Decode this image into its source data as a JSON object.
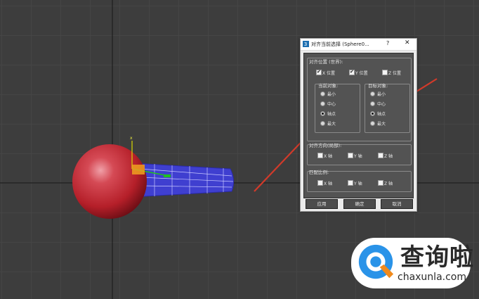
{
  "dialog": {
    "title": "对齐当前选择 (Sphere0...",
    "help": "?",
    "close": "✕",
    "align_position_label": "对齐位置 (世界):",
    "x_pos": {
      "label": "X 位置",
      "checked": true
    },
    "y_pos": {
      "label": "Y 位置",
      "checked": true
    },
    "z_pos": {
      "label": "Z 位置",
      "checked": false
    },
    "current_object": {
      "label": "当前对象:",
      "options": [
        "最小",
        "中心",
        "轴点",
        "最大"
      ],
      "selected": 2
    },
    "target_object": {
      "label": "目标对象:",
      "options": [
        "最小",
        "中心",
        "轴点",
        "最大"
      ],
      "selected": 2
    },
    "align_orientation": {
      "label": "对齐方向(局部):",
      "x": "X 轴",
      "y": "Y 轴",
      "z": "Z 轴"
    },
    "match_scale": {
      "label": "匹配比例:",
      "x": "X 轴",
      "y": "Y 轴",
      "z": "Z 轴"
    },
    "buttons": {
      "apply": "应用",
      "ok": "确定",
      "cancel": "取消"
    }
  },
  "gizmo": {
    "x_label": "x"
  },
  "watermark": {
    "brand": "查询啦",
    "url": "chaxunla.com"
  },
  "colors": {
    "sphere": "#b5202a",
    "cylinder": "#3f3fd0",
    "arrow": "#d23a2a",
    "dialog_dark": "#535353"
  }
}
